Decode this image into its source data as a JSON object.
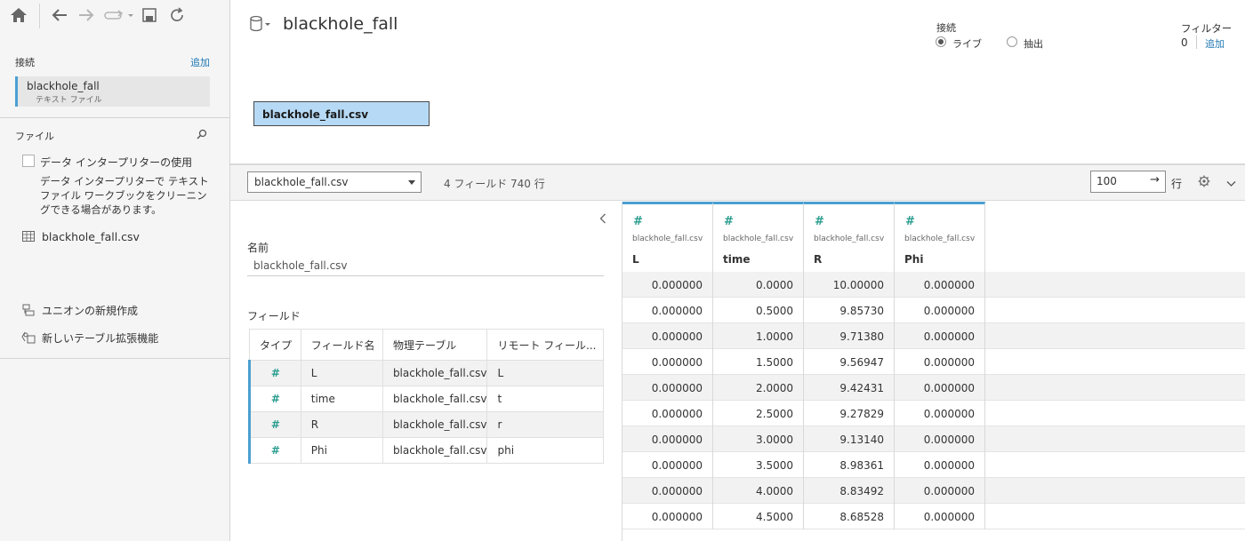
{
  "sidebar": {
    "connections_heading": "接続",
    "add_link": "追加",
    "connection": {
      "name": "blackhole_fall",
      "type": "テキスト ファイル"
    },
    "files_heading": "ファイル",
    "interpreter_label": "データ インタープリターの使用",
    "interpreter_desc": "データ インタープリターで テキスト ファイル ワークブックをクリーニングできる場合があります。",
    "file_item": "blackhole_fall.csv",
    "union_label": "ユニオンの新規作成",
    "extension_label": "新しいテーブル拡張機能"
  },
  "header": {
    "datasource_name": "blackhole_fall",
    "connection_label": "接続",
    "live_label": "ライブ",
    "extract_label": "抽出",
    "filter_label": "フィルター",
    "filter_count": "0",
    "filter_add": "追加"
  },
  "canvas": {
    "table_name": "blackhole_fall.csv"
  },
  "toolbar": {
    "table_select": "blackhole_fall.csv",
    "summary": "4 フィールド 740 行",
    "rows_value": "100",
    "rows_label": "行"
  },
  "meta": {
    "name_label": "名前",
    "name_value": "blackhole_fall.csv",
    "fields_label": "フィールド",
    "columns": [
      "タイプ",
      "フィールド名",
      "物理テーブル",
      "リモート フィール..."
    ],
    "rows": [
      {
        "type": "#",
        "field": "L",
        "table": "blackhole_fall.csv",
        "remote": "L"
      },
      {
        "type": "#",
        "field": "time",
        "table": "blackhole_fall.csv",
        "remote": "t"
      },
      {
        "type": "#",
        "field": "R",
        "table": "blackhole_fall.csv",
        "remote": "r"
      },
      {
        "type": "#",
        "field": "Phi",
        "table": "blackhole_fall.csv",
        "remote": "phi"
      }
    ]
  },
  "grid": {
    "columns": [
      {
        "source": "blackhole_fall.csv",
        "name": "L"
      },
      {
        "source": "blackhole_fall.csv",
        "name": "time"
      },
      {
        "source": "blackhole_fall.csv",
        "name": "R"
      },
      {
        "source": "blackhole_fall.csv",
        "name": "Phi"
      }
    ],
    "rows": [
      [
        "0.000000",
        "0.0000",
        "10.00000",
        "0.000000"
      ],
      [
        "0.000000",
        "0.5000",
        "9.85730",
        "0.000000"
      ],
      [
        "0.000000",
        "1.0000",
        "9.71380",
        "0.000000"
      ],
      [
        "0.000000",
        "1.5000",
        "9.56947",
        "0.000000"
      ],
      [
        "0.000000",
        "2.0000",
        "9.42431",
        "0.000000"
      ],
      [
        "0.000000",
        "2.5000",
        "9.27829",
        "0.000000"
      ],
      [
        "0.000000",
        "3.0000",
        "9.13140",
        "0.000000"
      ],
      [
        "0.000000",
        "3.5000",
        "8.98361",
        "0.000000"
      ],
      [
        "0.000000",
        "4.0000",
        "8.83492",
        "0.000000"
      ],
      [
        "0.000000",
        "4.5000",
        "8.68528",
        "0.000000"
      ]
    ]
  },
  "colors": {
    "accent": "#4a9fd1",
    "link": "#1f77b4",
    "number_type": "#2a9d8f",
    "selected_table": "#b6daf5"
  }
}
